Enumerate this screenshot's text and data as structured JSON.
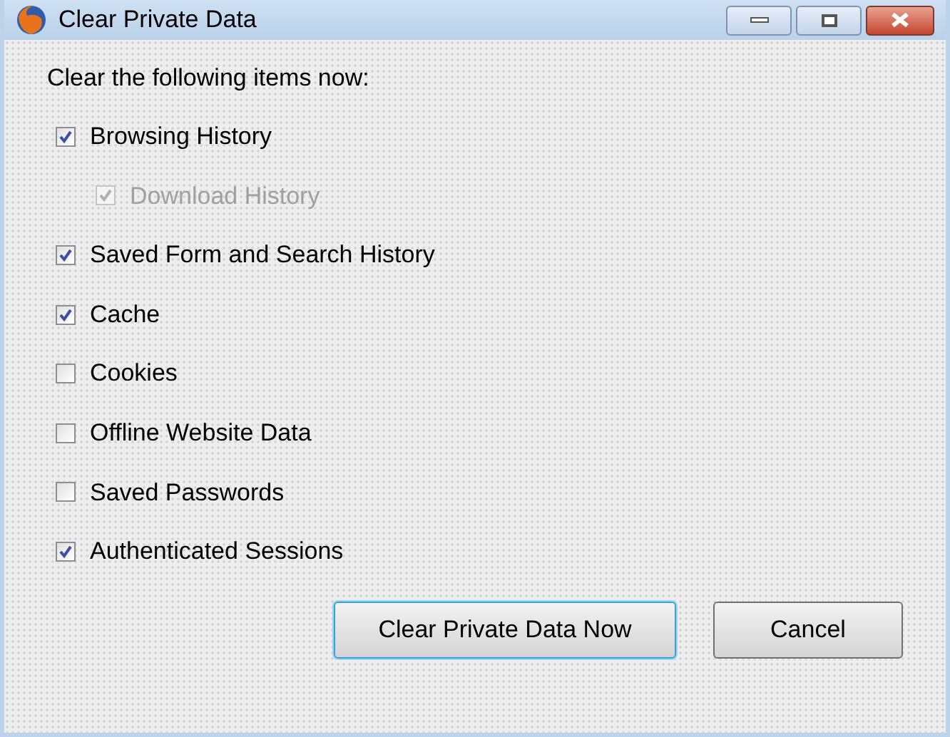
{
  "window": {
    "title": "Clear Private Data"
  },
  "heading": "Clear the following items now:",
  "items": [
    {
      "label": "Browsing History",
      "checked": true,
      "disabled": false,
      "children": [
        {
          "label": "Download History",
          "checked": true,
          "disabled": true
        }
      ]
    },
    {
      "label": "Saved Form and Search History",
      "checked": true,
      "disabled": false
    },
    {
      "label": "Cache",
      "checked": true,
      "disabled": false
    },
    {
      "label": "Cookies",
      "checked": false,
      "disabled": false
    },
    {
      "label": "Offline Website Data",
      "checked": false,
      "disabled": false
    },
    {
      "label": "Saved Passwords",
      "checked": false,
      "disabled": false
    },
    {
      "label": "Authenticated Sessions",
      "checked": true,
      "disabled": false
    }
  ],
  "buttons": [
    {
      "label": "Clear Private Data Now",
      "default": true
    },
    {
      "label": "Cancel",
      "default": false
    }
  ]
}
